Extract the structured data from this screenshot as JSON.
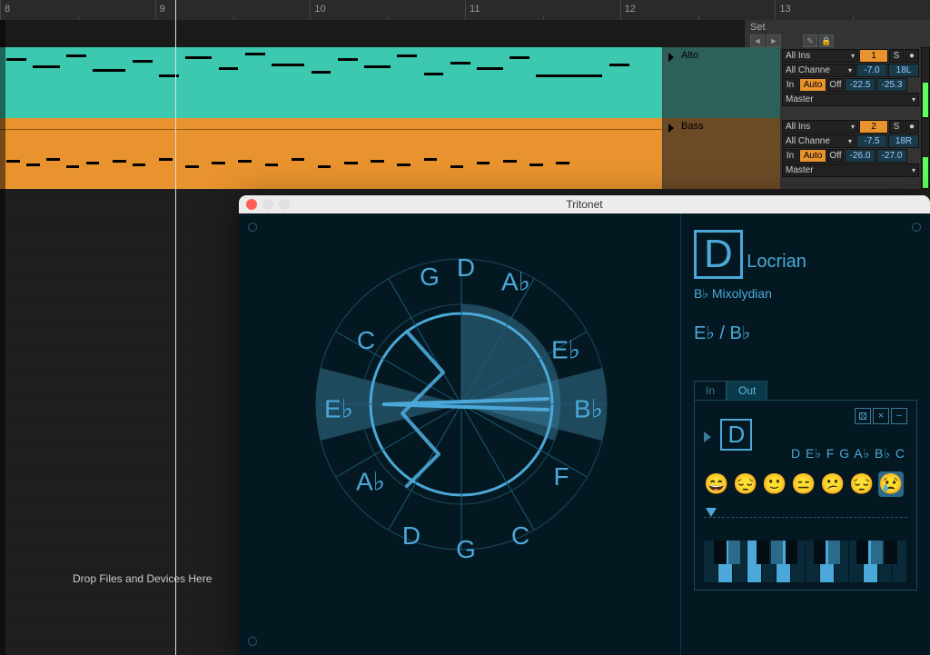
{
  "ruler": {
    "marks": [
      "8",
      "9",
      "10",
      "11",
      "12",
      "13"
    ]
  },
  "set": {
    "label": "Set"
  },
  "tracks": [
    {
      "name": "Alto",
      "color": "#3dc9b0",
      "mixer": {
        "input": "All Ins",
        "in_chan": "All Channe",
        "num": "1",
        "monitor_in": "In",
        "monitor_auto": "Auto",
        "monitor_off": "Off",
        "send": "-7.0",
        "pan": "18L",
        "peak1": "-22.5",
        "peak2": "-25.3",
        "out": "Master",
        "s": "S",
        "rec": "●"
      }
    },
    {
      "name": "Bass",
      "color": "#e8932e",
      "mixer": {
        "input": "All Ins",
        "in_chan": "All Channe",
        "num": "2",
        "monitor_in": "In",
        "monitor_auto": "Auto",
        "monitor_off": "Off",
        "send": "-7.5",
        "pan": "18R",
        "peak1": "-26.0",
        "peak2": "-27.0",
        "out": "Master",
        "s": "S",
        "rec": "●"
      }
    }
  ],
  "drop_hint": "Drop Files and Devices Here",
  "plugin": {
    "title": "Tritonet",
    "circle_notes": [
      "G",
      "D",
      "A♭",
      "C",
      "E♭",
      "E♭",
      "B♭",
      "A♭",
      "F",
      "D",
      "C",
      "G"
    ],
    "scale": {
      "root": "D",
      "mode": "Locrian",
      "sub": "B♭ Mixolydian",
      "chord": "E♭ / B♭"
    },
    "io": {
      "tab_in": "In",
      "tab_out": "Out"
    },
    "panel": {
      "note_string": "D E♭ F G A♭ B♭ C",
      "emojis": [
        "😄",
        "😔",
        "🙂",
        "😑",
        "😕",
        "😔",
        "😢"
      ],
      "selected_emoji_index": 6,
      "root_display": "D",
      "controls": {
        "dice": "⚄",
        "close": "×",
        "minus": "−"
      }
    }
  }
}
